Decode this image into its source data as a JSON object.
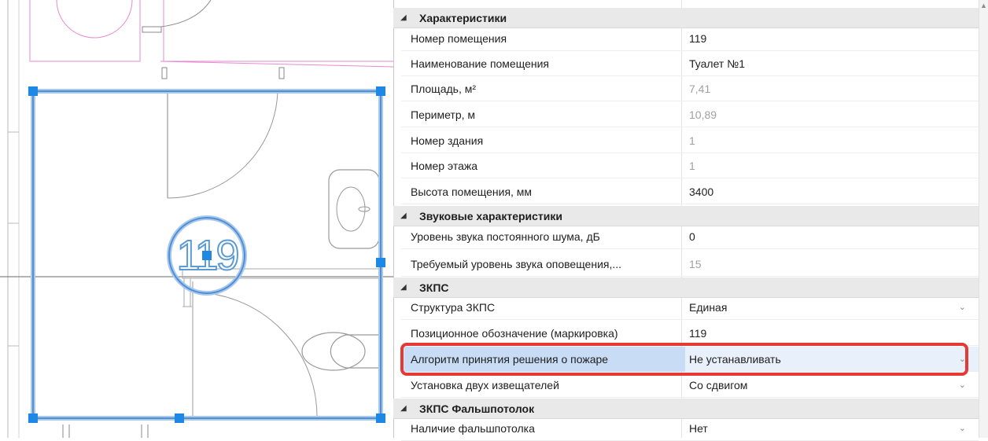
{
  "drawing": {
    "room_number": "119"
  },
  "properties": {
    "categories": [
      {
        "title": "Характеристики"
      },
      {
        "title": "Звуковые характеристики"
      },
      {
        "title": "ЗКПС"
      },
      {
        "title": "ЗКПС Фальшпотолок"
      }
    ],
    "rows": [
      {
        "name": "Номер помещения",
        "value": "119"
      },
      {
        "name": "Наименование помещения",
        "value": "Туалет №1"
      },
      {
        "name": "Площадь, м²",
        "value": "7,41"
      },
      {
        "name": "Периметр, м",
        "value": "10,89"
      },
      {
        "name": "Номер здания",
        "value": "1"
      },
      {
        "name": "Номер этажа",
        "value": "1"
      },
      {
        "name": "Высота помещения, мм",
        "value": "3400"
      },
      {
        "name": "Уровень звука постоянного шума, дБ",
        "value": "0"
      },
      {
        "name": "Требуемый уровень звука оповещения,...",
        "value": "15"
      },
      {
        "name": "Структура ЗКПС",
        "value": "Единая"
      },
      {
        "name": "Позиционное обозначение (маркировка)",
        "value": "119"
      },
      {
        "name": "Алгоритм принятия решения о пожаре",
        "value": "Не устанавливать"
      },
      {
        "name": "Установка двух извещателей",
        "value": "Со сдвигом"
      },
      {
        "name": "Наличие фальшпотолка",
        "value": "Нет"
      }
    ]
  },
  "icons": {
    "expand": "triangle-down-icon",
    "dropdown": "chevron-down-icon",
    "scroll_up": "arrow-up-icon"
  },
  "colors": {
    "selection": "#5b9bd5",
    "grip": "#1e88e5",
    "highlight": "#e53935",
    "walls": "#e88ad0"
  }
}
